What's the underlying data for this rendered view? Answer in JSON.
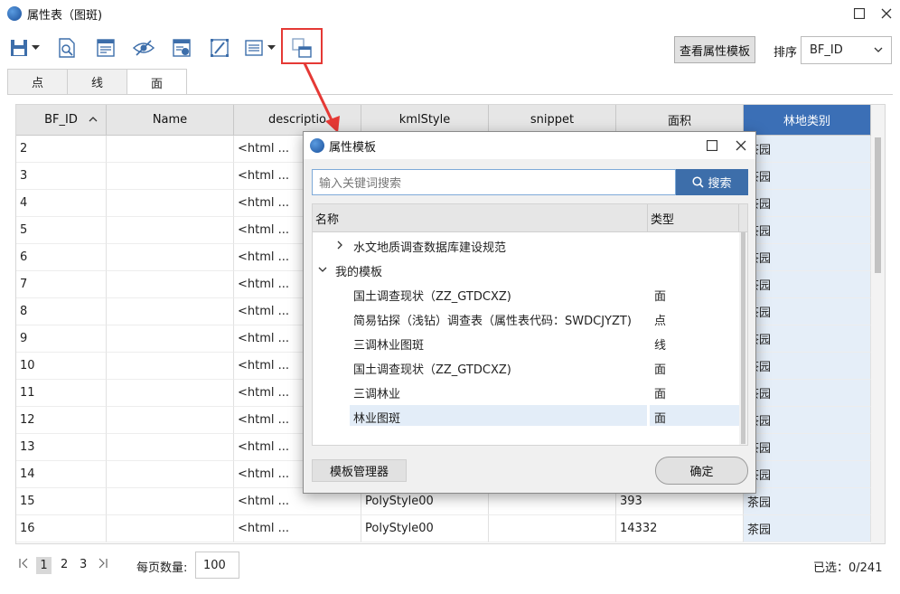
{
  "window": {
    "title": "属性表（图斑)"
  },
  "toolbar": {
    "icons": [
      "save-icon",
      "preview-icon",
      "edit-table-icon",
      "visibility-icon",
      "field-info-icon",
      "edit-style-icon",
      "list-icon",
      "attribute-template-icon"
    ],
    "view_template_label": "查看属性模板",
    "sort_label": "排序",
    "sort_value": "BF_ID"
  },
  "tabs": [
    {
      "label": "点"
    },
    {
      "label": "线"
    },
    {
      "label": "面"
    }
  ],
  "active_tab": "面",
  "table": {
    "columns": [
      "BF_ID",
      "Name",
      "descriptio",
      "kmlStyle",
      "snippet",
      "面积",
      "林地类别"
    ],
    "selected_column": "林地类别",
    "rows": [
      [
        "2",
        "",
        "<html ...",
        "",
        "",
        "",
        "茶园"
      ],
      [
        "3",
        "",
        "<html ...",
        "",
        "",
        "",
        "茶园"
      ],
      [
        "4",
        "",
        "<html ...",
        "",
        "",
        "",
        "茶园"
      ],
      [
        "5",
        "",
        "<html ...",
        "",
        "",
        "",
        "茶园"
      ],
      [
        "6",
        "",
        "<html ...",
        "",
        "",
        "",
        "茶园"
      ],
      [
        "7",
        "",
        "<html ...",
        "",
        "",
        "",
        "茶园"
      ],
      [
        "8",
        "",
        "<html ...",
        "",
        "",
        "",
        "茶园"
      ],
      [
        "9",
        "",
        "<html ...",
        "",
        "",
        "",
        "茶园"
      ],
      [
        "10",
        "",
        "<html ...",
        "",
        "",
        "",
        "茶园"
      ],
      [
        "11",
        "",
        "<html ...",
        "",
        "",
        "",
        "茶园"
      ],
      [
        "12",
        "",
        "<html ...",
        "",
        "",
        "",
        "茶园"
      ],
      [
        "13",
        "",
        "<html ...",
        "",
        "",
        "",
        "茶园"
      ],
      [
        "14",
        "",
        "<html ...",
        "",
        "",
        "",
        "茶园"
      ],
      [
        "15",
        "",
        "<html ...",
        "PolyStyle00",
        "",
        "393",
        "茶园"
      ],
      [
        "16",
        "",
        "<html ...",
        "PolyStyle00",
        "",
        "14332",
        "茶园"
      ]
    ]
  },
  "pager": {
    "pages": [
      "1",
      "2",
      "3"
    ],
    "current": "1",
    "page_size_label": "每页数量:",
    "page_size": "100",
    "selection": "已选：0/241"
  },
  "dialog": {
    "title": "属性模板",
    "search_placeholder": "输入关键词搜索",
    "search_button": "搜索",
    "columns": [
      "名称",
      "类型"
    ],
    "tree": [
      {
        "label": "水文地质调查数据库建设规范",
        "type": "",
        "level": 0,
        "expanded": false
      },
      {
        "label": "我的模板",
        "type": "",
        "level": 0,
        "expanded": true
      },
      {
        "label": "国土调查现状（ZZ_GTDCXZ)",
        "type": "面",
        "level": 1
      },
      {
        "label": "简易钻探（浅钻）调查表（属性表代码：SWDCJYZT)",
        "type": "点",
        "level": 1
      },
      {
        "label": "三调林业图斑",
        "type": "线",
        "level": 1
      },
      {
        "label": "国土调查现状（ZZ_GTDCXZ)",
        "type": "面",
        "level": 1
      },
      {
        "label": "三调林业",
        "type": "面",
        "level": 1
      },
      {
        "label": "林业图斑",
        "type": "面",
        "level": 1,
        "selected": true
      }
    ],
    "manage_button": "模板管理器",
    "ok_button": "确定"
  },
  "colors": {
    "accent": "#3d6eaa",
    "selected_header": "#3b6fb6",
    "annotation": "#e53935"
  }
}
